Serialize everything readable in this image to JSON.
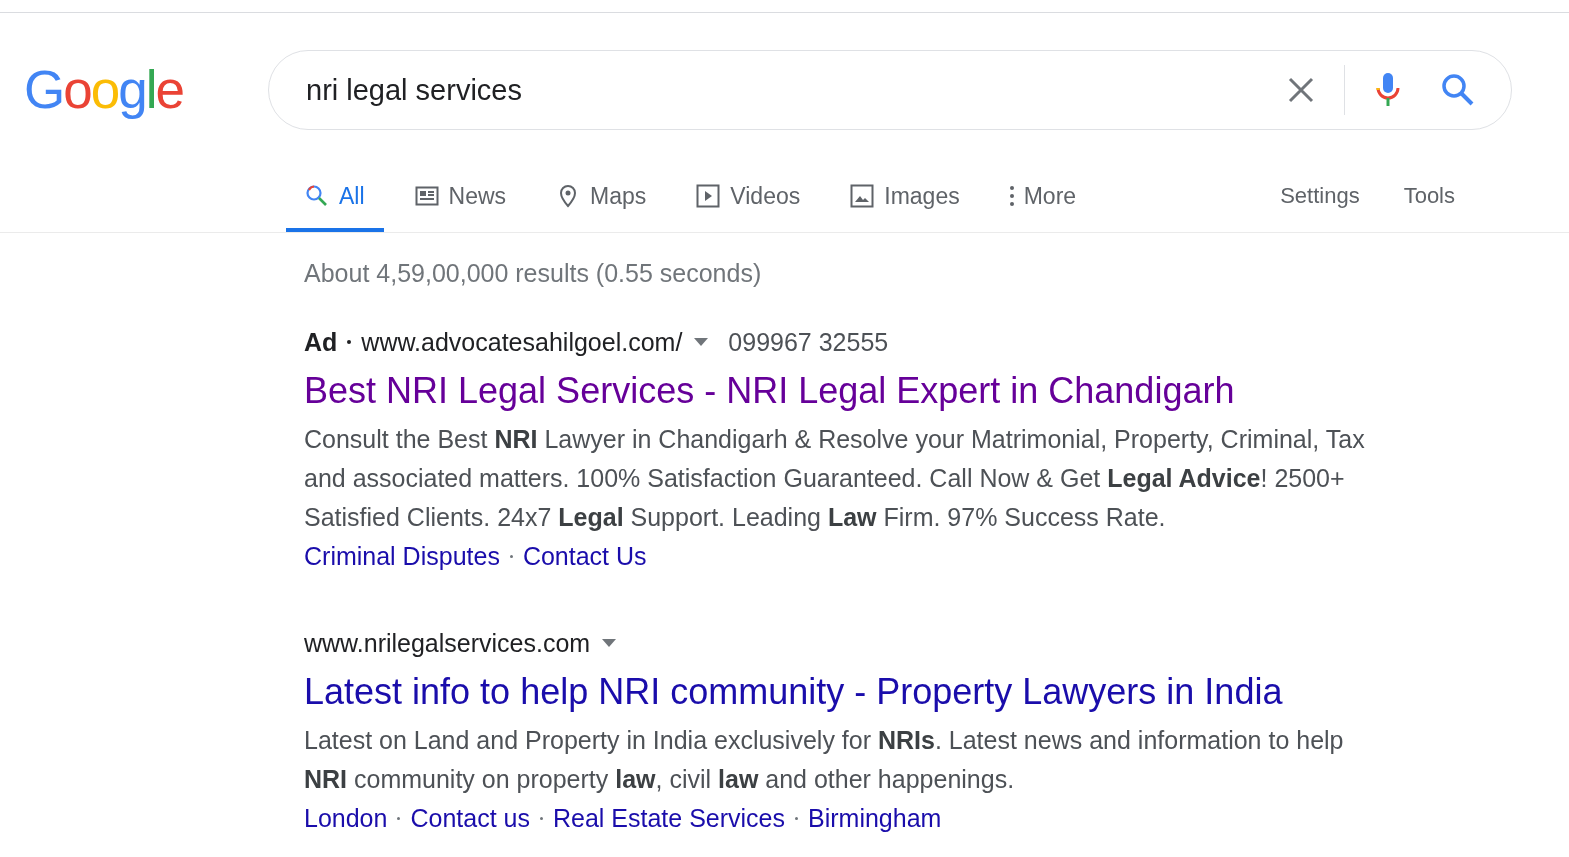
{
  "logo": {
    "text": "Google"
  },
  "search": {
    "value": "nri legal services"
  },
  "tabs": [
    {
      "label": "All",
      "kind": "search",
      "selected": true
    },
    {
      "label": "News",
      "kind": "news",
      "selected": false
    },
    {
      "label": "Maps",
      "kind": "pin",
      "selected": false
    },
    {
      "label": "Videos",
      "kind": "play",
      "selected": false
    },
    {
      "label": "Images",
      "kind": "image",
      "selected": false
    },
    {
      "label": "More",
      "kind": "dots",
      "selected": false
    }
  ],
  "tools": [
    "Settings",
    "Tools"
  ],
  "result_stats": "About 4,59,00,000 results (0.55 seconds)",
  "results": [
    {
      "badge": "Ad",
      "url": "www.advocatesahilgoel.com/",
      "phone": "099967 32555",
      "title": "Best NRI Legal Services - NRI Legal Expert in Chandigarh",
      "visited": true,
      "snippet": "Consult the Best **NRI** Lawyer in Chandigarh & Resolve your Matrimonial, Property, Criminal, Tax and associated matters. 100% Satisfaction Guaranteed. Call Now & Get **Legal Advice**! 2500+ Satisfied Clients. 24x7 **Legal** Support. Leading **Law** Firm. 97% Success Rate.",
      "sitelinks": [
        "Criminal Disputes",
        "Contact Us"
      ]
    },
    {
      "url": "www.nrilegalservices.com",
      "title": "Latest info to help NRI community - Property Lawyers in India",
      "visited": false,
      "snippet": "Latest on Land and Property in India exclusively for **NRIs**. Latest news and information to help **NRI** community on property **law**, civil **law** and other happenings.",
      "sitelinks": [
        "London",
        "Contact us",
        "Real Estate Services",
        "Birmingham"
      ]
    }
  ]
}
